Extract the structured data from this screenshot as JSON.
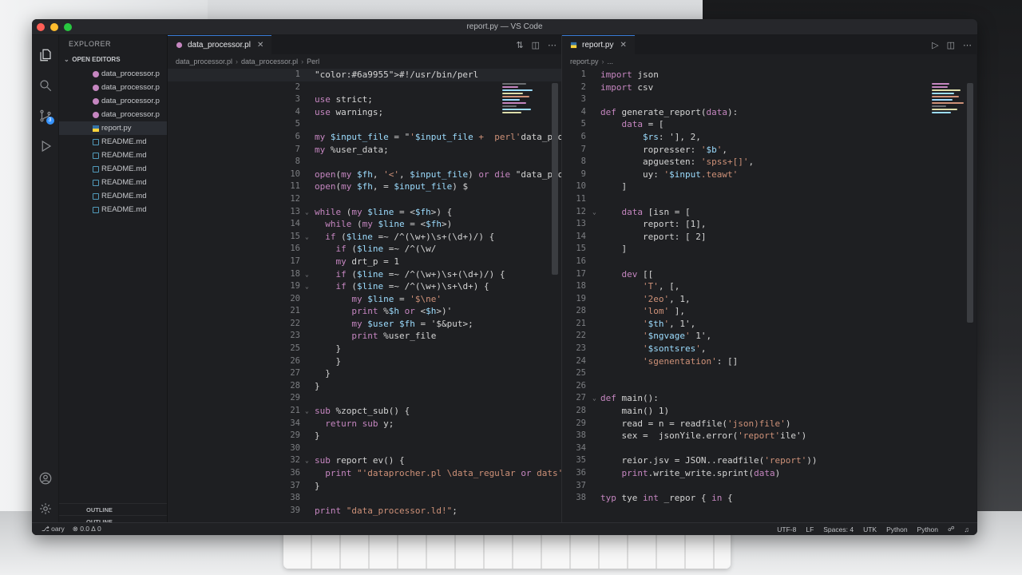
{
  "window": {
    "title": "report.py — VS Code"
  },
  "activity_bar": {
    "scm_badge": "3"
  },
  "explorer": {
    "header": "EXPLORER",
    "open_editors_label": "OPEN EDITORS",
    "files": [
      {
        "name": "data_processor.p",
        "type": "perl",
        "active": false
      },
      {
        "name": "data_processor.p",
        "type": "perl",
        "active": false
      },
      {
        "name": "data_processor.p",
        "type": "perl",
        "active": false
      },
      {
        "name": "data_processor.p",
        "type": "perl",
        "active": false
      },
      {
        "name": "report.py",
        "type": "python",
        "active": true
      },
      {
        "name": "README.md",
        "type": "md",
        "active": false
      },
      {
        "name": "README.md",
        "type": "md",
        "active": false
      },
      {
        "name": "README.md",
        "type": "md",
        "active": false
      },
      {
        "name": "README.md",
        "type": "md",
        "active": false
      },
      {
        "name": "README.md",
        "type": "md",
        "active": false
      },
      {
        "name": "README.md",
        "type": "md",
        "active": false
      }
    ],
    "footer_sections": [
      "OUTLINE",
      "OUTLINE"
    ]
  },
  "left_editor": {
    "tab_label": "data_processor.pl",
    "breadcrumbs": [
      "data_processor.pl",
      "data_processor.pl",
      "Perl"
    ],
    "lines": [
      {
        "n": "1",
        "text": "#!/usr/bin/perl"
      },
      {
        "n": "2",
        "text": ""
      },
      {
        "n": "3",
        "text": "use strict;"
      },
      {
        "n": "4",
        "text": "use warnings;"
      },
      {
        "n": "5",
        "text": ""
      },
      {
        "n": "6",
        "text": "my $input_file = \"'$input_file +  perl'data_processor.pl"
      },
      {
        "n": "7",
        "text": "my %user_data;"
      },
      {
        "n": "8",
        "text": ""
      },
      {
        "n": "10",
        "text": "open(my $fh, '<', $input_file) or die \"data_processor.pl"
      },
      {
        "n": "11",
        "text": "open(my $fh, = $input_file) $"
      },
      {
        "n": "12",
        "text": ""
      },
      {
        "n": "13",
        "text": "while (my $line = <$fh>) {",
        "fold": true
      },
      {
        "n": "14",
        "text": "  while (my $line = <$fh>)"
      },
      {
        "n": "15",
        "text": "  if ($line =~ /^(\\w+)\\s+(\\d+)/) {",
        "fold": true
      },
      {
        "n": "16",
        "text": "    if ($line =~ /^(\\w/"
      },
      {
        "n": "17",
        "text": "    my drt_p = 1"
      },
      {
        "n": "18",
        "text": "    if ($line =~ /^(\\w+)\\s+(\\d+)/) {",
        "fold": true
      },
      {
        "n": "19",
        "text": "    if ($line =~ /^(\\w+)\\s+\\d+) {",
        "fold": true
      },
      {
        "n": "20",
        "text": "       my $line = '$\\ne'"
      },
      {
        "n": "21",
        "text": "       print %$h or <$h>)'"
      },
      {
        "n": "22",
        "text": "       my $user $fh = '$&put>;"
      },
      {
        "n": "23",
        "text": "       print %user_file"
      },
      {
        "n": "25",
        "text": "    }"
      },
      {
        "n": "26",
        "text": "    }"
      },
      {
        "n": "27",
        "text": "  }"
      },
      {
        "n": "28",
        "text": "}"
      },
      {
        "n": "29",
        "text": ""
      },
      {
        "n": "21",
        "text": "sub %zopct_sub() {",
        "fold": true
      },
      {
        "n": "34",
        "text": "  return sub y;"
      },
      {
        "n": "29",
        "text": "}"
      },
      {
        "n": "30",
        "text": ""
      },
      {
        "n": "32",
        "text": "sub report ev() {",
        "fold": true
      },
      {
        "n": "36",
        "text": "  print \"'dataprocher.pl \\data_regular or dats'\";"
      },
      {
        "n": "37",
        "text": "}"
      },
      {
        "n": "38",
        "text": ""
      },
      {
        "n": "39",
        "text": "print \"data_processor.ld!\";"
      }
    ]
  },
  "right_editor": {
    "tab_label": "report.py",
    "breadcrumbs": [
      "report.py",
      "..."
    ],
    "lines": [
      {
        "n": "1",
        "text": "import json"
      },
      {
        "n": "2",
        "text": "import csv"
      },
      {
        "n": "3",
        "text": ""
      },
      {
        "n": "4",
        "text": "def generate_report(data):"
      },
      {
        "n": "5",
        "text": "    data = ["
      },
      {
        "n": "6",
        "text": "        $rs: '], 2,"
      },
      {
        "n": "7",
        "text": "        ropresser: '$b',"
      },
      {
        "n": "8",
        "text": "        apguesten: 'spss+[]',"
      },
      {
        "n": "9",
        "text": "        uy: '$input.teawt'"
      },
      {
        "n": "10",
        "text": "    ]"
      },
      {
        "n": "11",
        "text": ""
      },
      {
        "n": "12",
        "text": "    data [isn = [",
        "fold": true
      },
      {
        "n": "13",
        "text": "        report: [1],"
      },
      {
        "n": "14",
        "text": "        report: [ 2]"
      },
      {
        "n": "15",
        "text": "    ]"
      },
      {
        "n": "16",
        "text": ""
      },
      {
        "n": "17",
        "text": "    dev [["
      },
      {
        "n": "18",
        "text": "        'T', [,"
      },
      {
        "n": "19",
        "text": "        '2eo', 1,"
      },
      {
        "n": "28",
        "text": "        'lom' ],"
      },
      {
        "n": "21",
        "text": "        '$th', 1',"
      },
      {
        "n": "22",
        "text": "        '$ngvage' 1',"
      },
      {
        "n": "23",
        "text": "        '$sontsres',"
      },
      {
        "n": "24",
        "text": "        'sgenentation': []"
      },
      {
        "n": "25",
        "text": ""
      },
      {
        "n": "26",
        "text": ""
      },
      {
        "n": "27",
        "text": "def main():",
        "fold": true
      },
      {
        "n": "28",
        "text": "    main() 1)"
      },
      {
        "n": "29",
        "text": "    read = n = readfile('json)file')"
      },
      {
        "n": "38",
        "text": "    sex =  jsonYile.error('report'ile')"
      },
      {
        "n": "34",
        "text": ""
      },
      {
        "n": "35",
        "text": "    reior.jsv = JSON..readfile('report'))"
      },
      {
        "n": "36",
        "text": "    print.write_write.sprint(data)"
      },
      {
        "n": "37",
        "text": ""
      },
      {
        "n": "38",
        "text": "typ tye int _repor { in {"
      }
    ]
  },
  "status_bar": {
    "branch": "oary",
    "problems": "0.0 ∆ 0",
    "encoding": "UTF-8",
    "eol": "LF",
    "indent": "Spaces: 4",
    "charset": "UTK",
    "language1": "Python",
    "language2": "Python"
  },
  "colors": {
    "keyword": "#c586c0",
    "function": "#dcdcaa",
    "string": "#ce9178",
    "comment": "#6a9955",
    "variable": "#9cdcfe",
    "accent": "#3794ff"
  }
}
